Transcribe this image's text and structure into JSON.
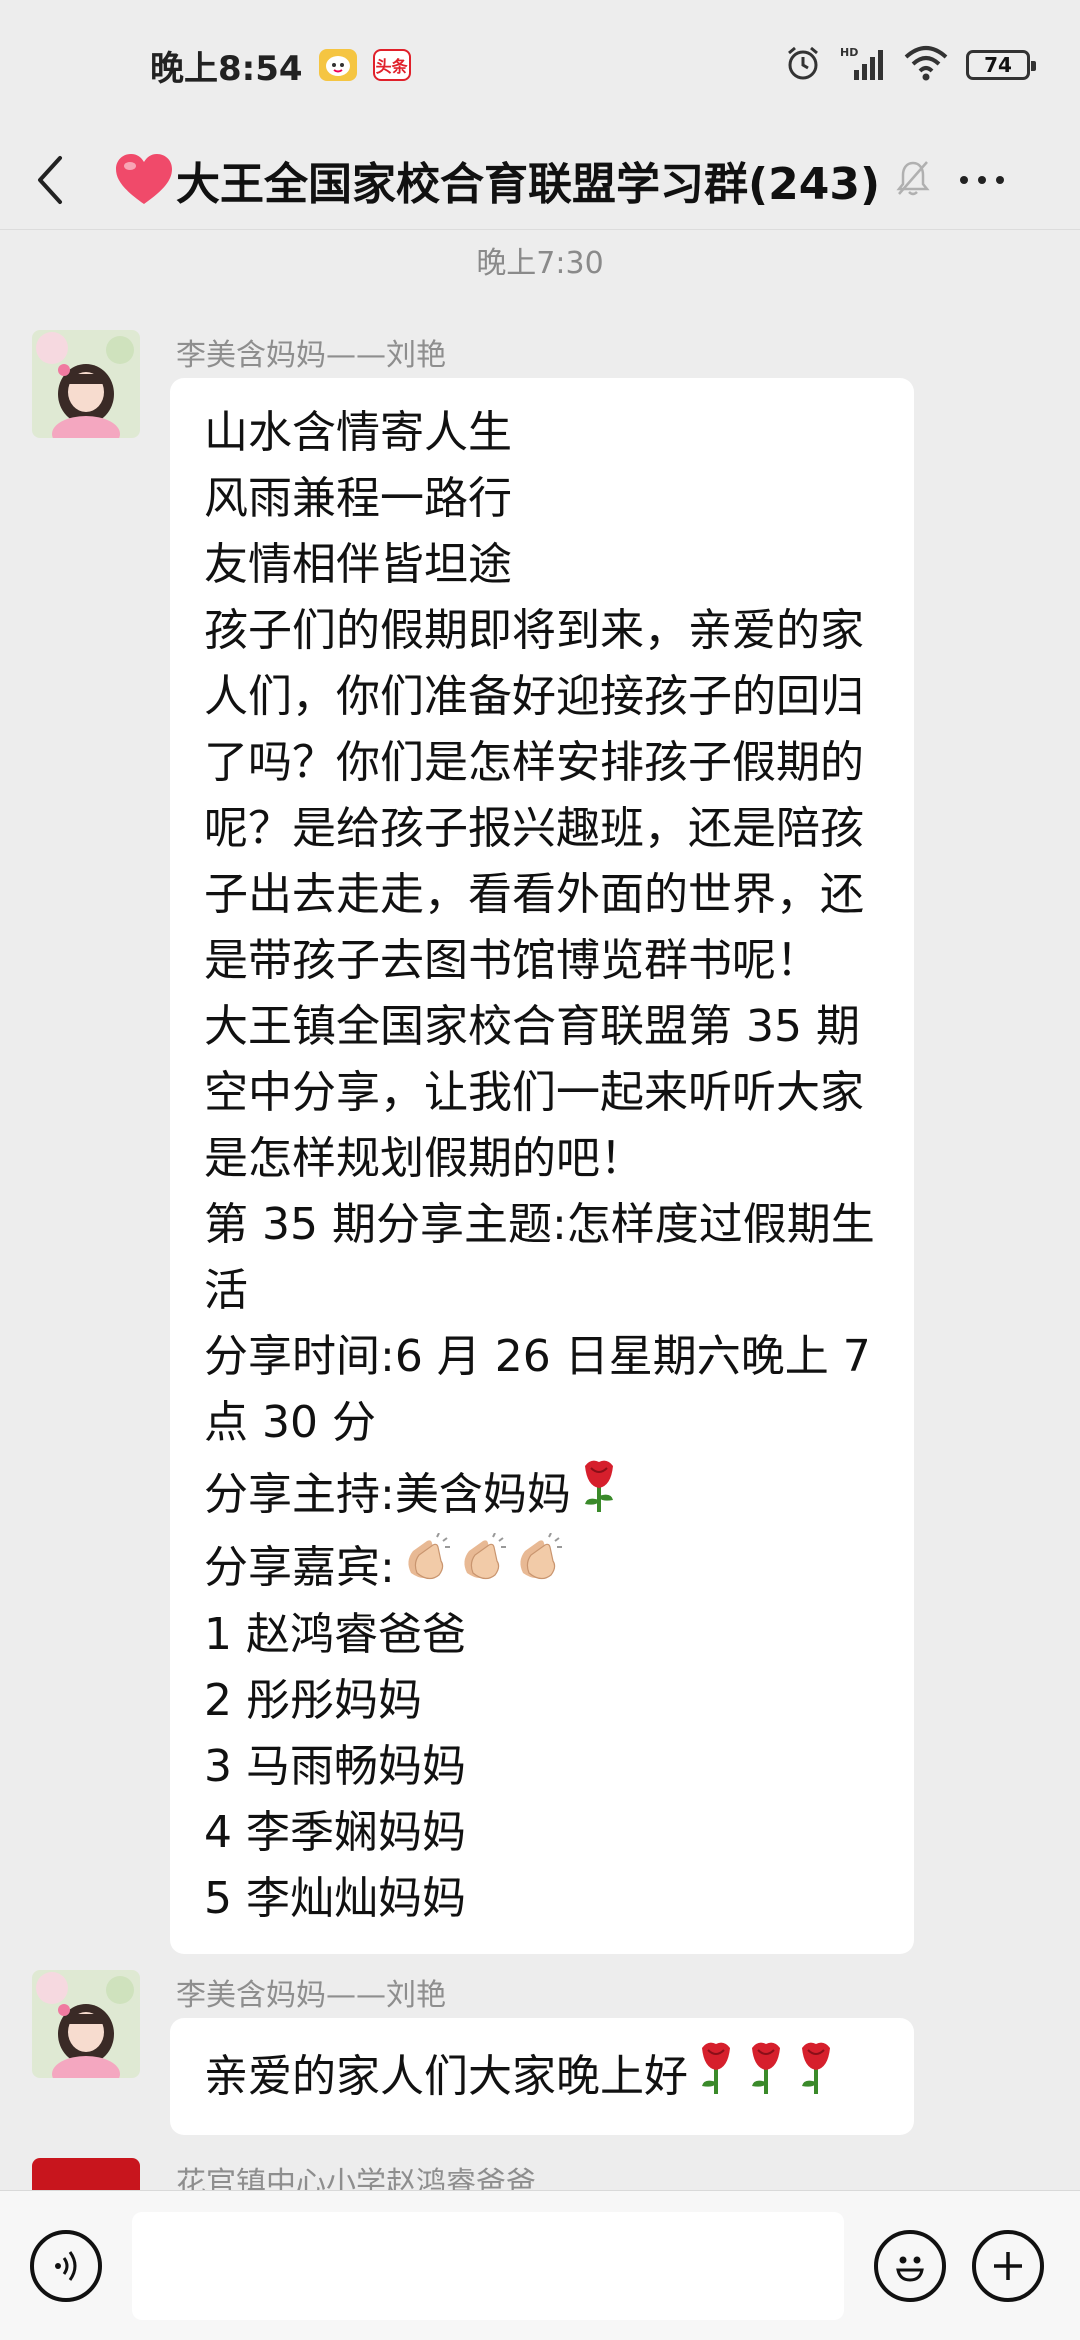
{
  "status_bar": {
    "time": "晚上8:54",
    "app_badge_2": "头条",
    "battery": "74"
  },
  "header": {
    "title": "大王全国家校合育联盟学习群(243)"
  },
  "timestamp": "晚上7:30",
  "messages": [
    {
      "sender": "李美含妈妈——刘艳",
      "lines": [
        "山水含情寄人生",
        "风雨兼程一路行",
        "友情相伴皆坦途",
        "孩子们的假期即将到来，亲爱的家",
        "人们，你们准备好迎接孩子的回归",
        "了吗？你们是怎样安排孩子假期的",
        "呢？是给孩子报兴趣班，还是陪孩",
        "子出去走走，看看外面的世界，还",
        "是带孩子去图书馆博览群书呢！",
        "大王镇全国家校合育联盟第 35 期",
        "空中分享，让我们一起来听听大家",
        "是怎样规划假期的吧！",
        "第 35 期分享主题:怎样度过假期生",
        "活",
        "分享时间:6 月 26 日星期六晚上 7",
        "点 30 分",
        "分享主持:美含妈妈",
        "分享嘉宾:",
        "1 赵鸿睿爸爸",
        "2 彤彤妈妈",
        "3 马雨畅妈妈",
        "4 李季娴妈妈",
        "5 李灿灿妈妈"
      ]
    },
    {
      "sender": "李美含妈妈——刘艳",
      "lines": [
        "亲爱的家人们大家晚上好"
      ]
    },
    {
      "sender": "花官镇中心小学赵鸿睿爸爸"
    }
  ],
  "icons": {
    "back": "chevron-left-icon",
    "mute": "bell-muted-icon",
    "more": "more-dots-icon",
    "voice": "voice-icon",
    "emoji": "smiley-icon",
    "add": "plus-icon",
    "rose": "rose-emoji",
    "clap": "clap-emoji"
  },
  "colors": {
    "background": "#ededed",
    "bubble": "#ffffff",
    "heart": "#f04a6a"
  }
}
